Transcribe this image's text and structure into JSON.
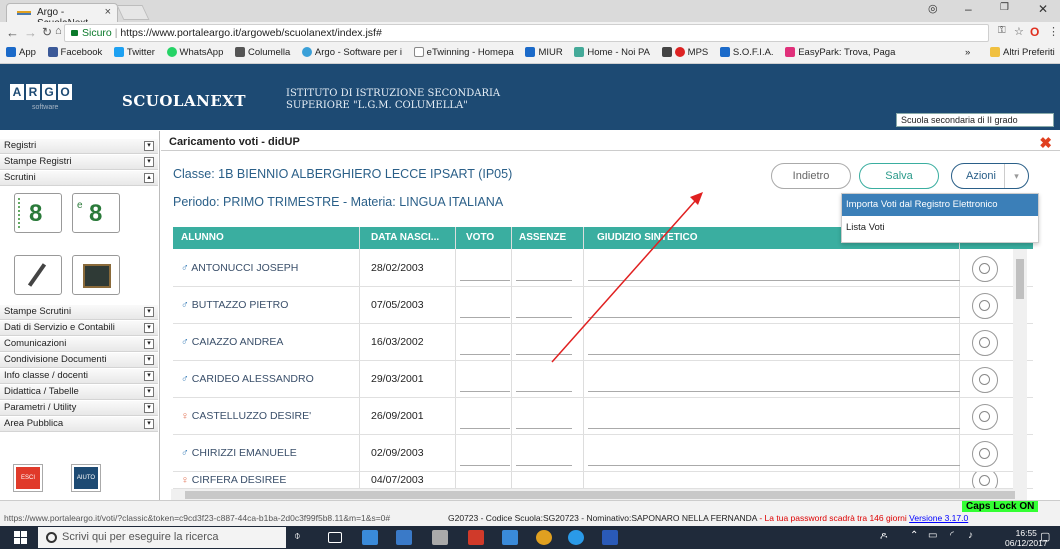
{
  "browser": {
    "tab_title": "Argo - ScuolaNext",
    "tab_close": "×",
    "url_secure": "Sicuro",
    "url": "https://www.portaleargo.it/argoweb/scuolanext/index.jsf#",
    "bookmarks": [
      "App",
      "Facebook",
      "Twitter",
      "WhatsApp",
      "Columella",
      "Argo - Software per i",
      "eTwinning - Homepa",
      "MIUR",
      "Home - Noi PA",
      "MPS",
      "S.O.F.I.A.",
      "EasyPark: Trova, Paga"
    ],
    "bookmarks_more": "»",
    "bookmarks_other": "Altri Preferiti"
  },
  "header": {
    "logo": "ARGO",
    "logo_sub": "software",
    "app_name": "SCUOLANEXT",
    "school_line1": "ISTITUTO DI ISTRUZIONE SECONDARIA",
    "school_line2": "SUPERIORE \"L.G.M. COLUMELLA\"",
    "school_type": "Scuola secondaria di II grado"
  },
  "sidebar": {
    "top_items": [
      "Registri",
      "Stampe Registri",
      "Scrutini"
    ],
    "icon_labels": [
      "8",
      "8"
    ],
    "items": [
      "Stampe Scrutini",
      "Dati di Servizio e Contabili",
      "Comunicazioni",
      "Condivisione Documenti",
      "Info classe / docenti",
      "Didattica / Tabelle",
      "Parametri / Utility",
      "Area Pubblica"
    ],
    "esci": "ESCI",
    "aiuto": "AIUTO"
  },
  "main": {
    "title": "Caricamento voti - didUP",
    "classe": "Classe: 1B BIENNIO ALBERGHIERO LECCE IPSART (IP05)",
    "periodo": "Periodo: PRIMO TRIMESTRE - Materia: LINGUA ITALIANA",
    "btn_indietro": "Indietro",
    "btn_salva": "Salva",
    "btn_azioni": "Azioni",
    "menu_importa": "Importa Voti dal Registro Elettronico",
    "menu_lista": "Lista Voti",
    "columns": [
      "ALUNNO",
      "DATA NASCI...",
      "VOTO",
      "ASSENZE",
      "GIUDIZIO SINTETICO"
    ],
    "students": [
      {
        "name": "ANTONUCCI JOSEPH",
        "dob": "28/02/2003",
        "gender": "♂"
      },
      {
        "name": "BUTTAZZO PIETRO",
        "dob": "07/05/2003",
        "gender": "♂"
      },
      {
        "name": "CAIAZZO ANDREA",
        "dob": "16/03/2002",
        "gender": "♂"
      },
      {
        "name": "CARIDEO ALESSANDRO",
        "dob": "29/03/2001",
        "gender": "♂"
      },
      {
        "name": "CASTELLUZZO DESIRE'",
        "dob": "26/09/2001",
        "gender": "♀"
      },
      {
        "name": "CHIRIZZI EMANUELE",
        "dob": "02/09/2003",
        "gender": "♂"
      },
      {
        "name": "CIRFERA DESIREE",
        "dob": "04/07/2003",
        "gender": "♀"
      }
    ]
  },
  "status": {
    "url": "https://www.portaleargo.it/voti/?classic&token=c9cd3f23-c887-44ca-b1ba-2d0c3f99f5b8.11&m=1&s=0#",
    "info": "G20723 - Codice Scuola:SG20723 - Nominativo:SAPONARO NELLA FERNANDA",
    "warning": "- La tua password scadrà tra 146 giorni",
    "version": "Versione 3.17.0",
    "caps": "Caps Lock ON"
  },
  "taskbar": {
    "search": "Scrivi qui per eseguire la ricerca",
    "time": "16:55",
    "date": "06/12/2017"
  },
  "colors": {
    "header_bg": "#1d4a73",
    "table_header": "#3aaea0",
    "accent_blue": "#2a5f88",
    "arrow": "#e02020"
  }
}
